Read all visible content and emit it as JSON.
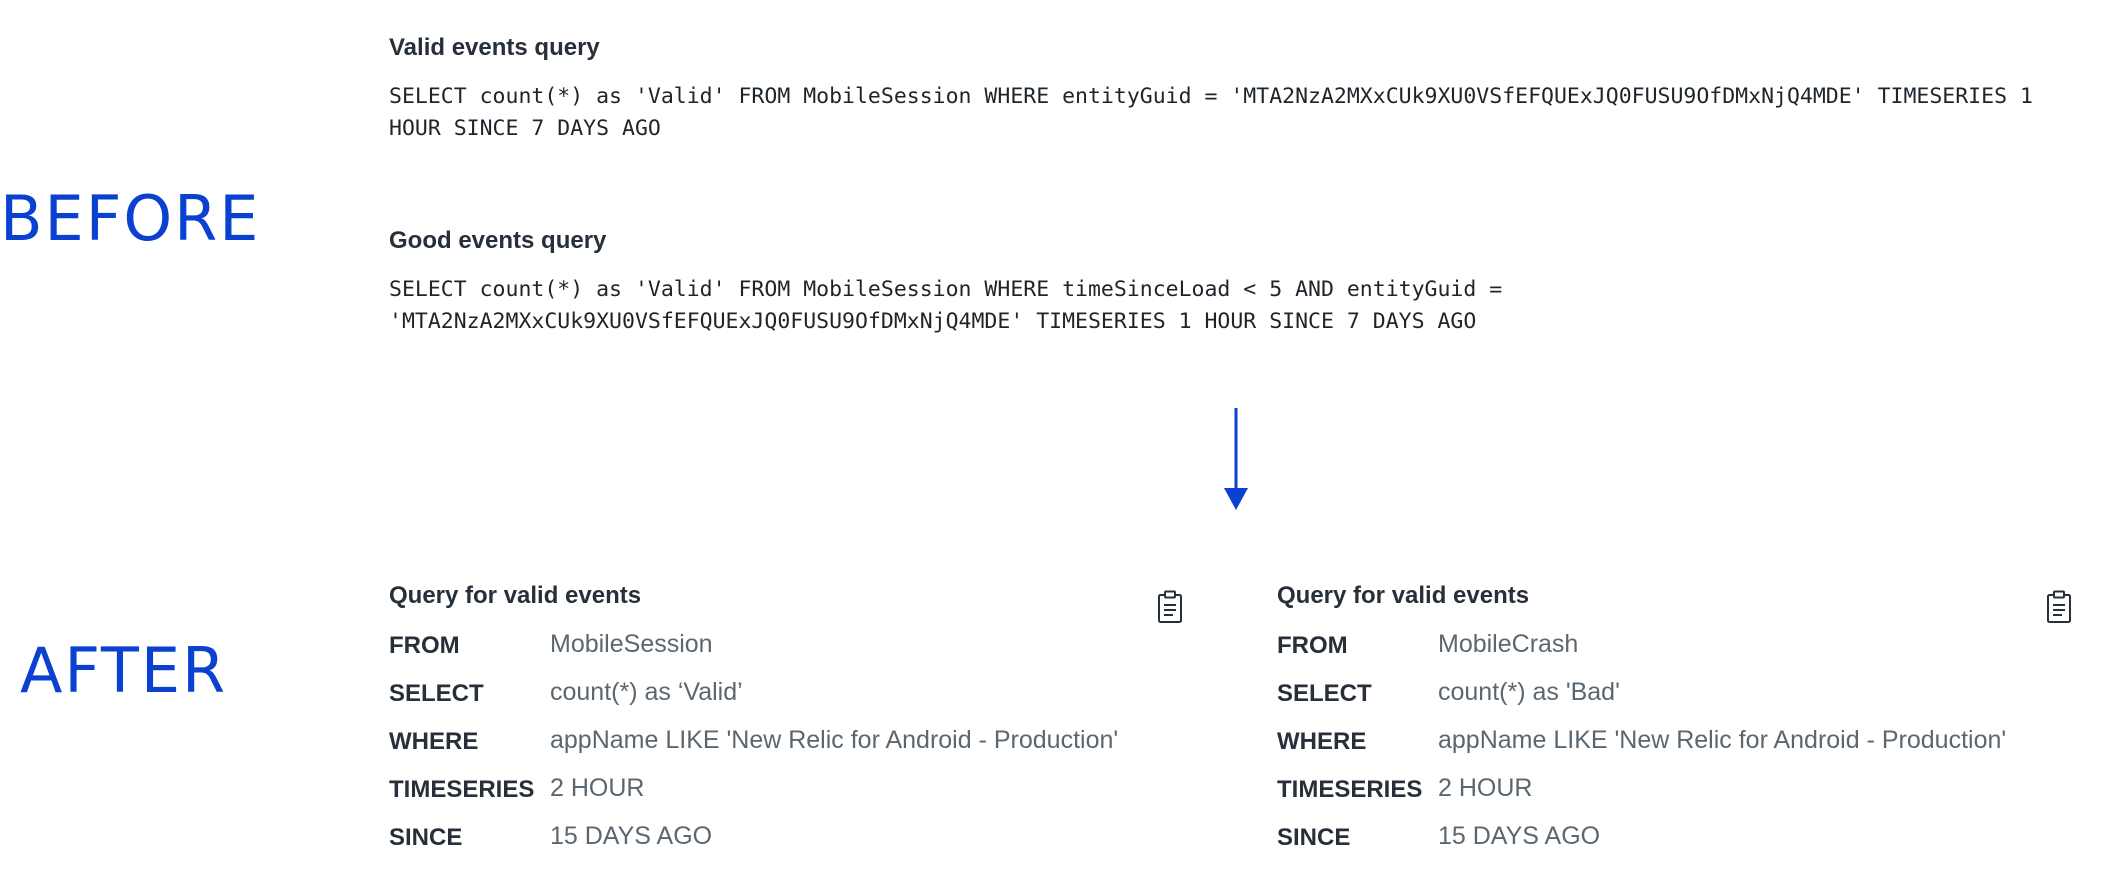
{
  "before": {
    "label": "BEFORE",
    "valid_query": {
      "title": "Valid events query",
      "line1": "SELECT count(*) as 'Valid' FROM MobileSession WHERE entityGuid = 'MTA2NzA2MXxCUk9XU0VSfEFQUExJQ0FUSU9OfDMxNjQ4MDE' TIMESERIES 1",
      "line2": "HOUR SINCE 7 DAYS AGO"
    },
    "good_query": {
      "title": "Good events query",
      "line1": "SELECT count(*) as 'Valid' FROM MobileSession WHERE timeSinceLoad < 5 AND entityGuid =",
      "line2": "'MTA2NzA2MXxCUk9XU0VSfEFQUExJQ0FUSU9OfDMxNjQ4MDE' TIMESERIES 1 HOUR SINCE 7 DAYS AGO"
    }
  },
  "after": {
    "label": "AFTER",
    "cards": [
      {
        "title": "Query for valid events",
        "icon": "clipboard-icon",
        "rows": [
          {
            "key": "FROM",
            "value": "MobileSession"
          },
          {
            "key": "SELECT",
            "value": "count(*) as ‘Valid’"
          },
          {
            "key": "WHERE",
            "value": "appName LIKE 'New Relic for Android - Production'"
          },
          {
            "key": "TIMESERIES",
            "value": "2 HOUR"
          },
          {
            "key": "SINCE",
            "value": "15 DAYS AGO"
          }
        ]
      },
      {
        "title": "Query for valid events",
        "icon": "clipboard-icon",
        "rows": [
          {
            "key": "FROM",
            "value": "MobileCrash"
          },
          {
            "key": "SELECT",
            "value": "count(*) as 'Bad'"
          },
          {
            "key": "WHERE",
            "value": "appName LIKE 'New Relic for Android - Production'"
          },
          {
            "key": "TIMESERIES",
            "value": "2 HOUR"
          },
          {
            "key": "SINCE",
            "value": "15 DAYS AGO"
          }
        ]
      }
    ]
  },
  "colors": {
    "accent": "#0b41d1",
    "heading": "#27303a",
    "value_text": "#5b6770"
  },
  "arrow_icon": "arrow-down-icon"
}
